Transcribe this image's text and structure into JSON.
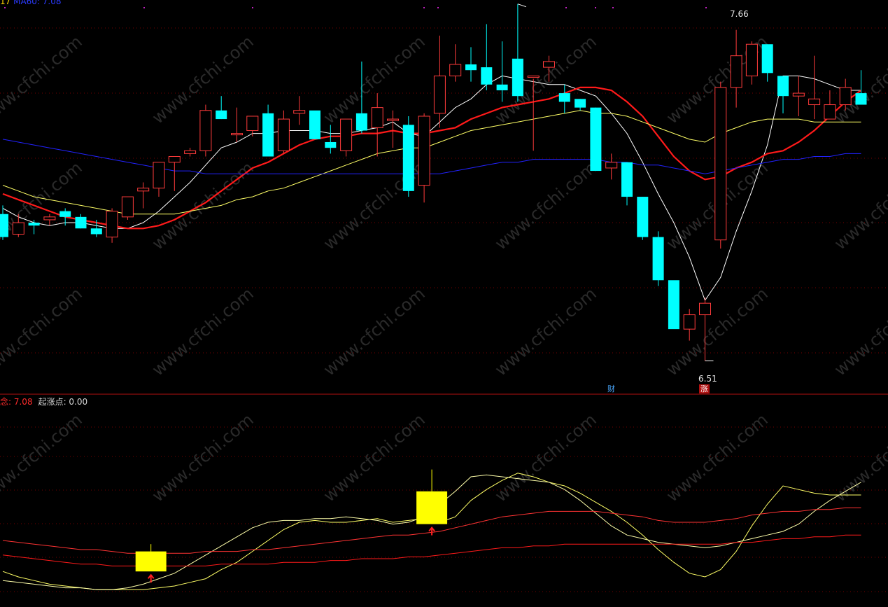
{
  "legend": {
    "top_fragment_1": "17",
    "top_fragment_2": "MA60: 7.08",
    "lower_value": "念: 7.08",
    "lower_start_label": "起涨点: 0.00"
  },
  "annotations": {
    "high_label": "7.66",
    "low_label": "6.51",
    "tag_cai": "财",
    "tag_zhang": "涨"
  },
  "colors": {
    "background": "#000000",
    "up_candle": "#ff3b3b",
    "down_candle": "#00ffff",
    "ma_white": "#ffffff",
    "ma_red": "#ff1a1a",
    "ma_yellow": "#ffff66",
    "ma_blue": "#2222ff",
    "signal_box": "#ffff00",
    "grid": "#8b0000"
  },
  "chart_data": [
    {
      "type": "candlestick",
      "title": "",
      "ylim": [
        6.45,
        7.72
      ],
      "grid": true,
      "candles": [
        {
          "o": 7.02,
          "h": 7.05,
          "l": 6.93,
          "c": 6.94
        },
        {
          "o": 6.95,
          "h": 7.02,
          "l": 6.94,
          "c": 6.99
        },
        {
          "o": 6.99,
          "h": 7.0,
          "l": 6.95,
          "c": 6.98
        },
        {
          "o": 7.0,
          "h": 7.02,
          "l": 6.98,
          "c": 7.01
        },
        {
          "o": 7.03,
          "h": 7.04,
          "l": 6.98,
          "c": 7.01
        },
        {
          "o": 7.01,
          "h": 7.02,
          "l": 6.97,
          "c": 6.97
        },
        {
          "o": 6.97,
          "h": 7.0,
          "l": 6.94,
          "c": 6.95
        },
        {
          "o": 6.94,
          "h": 7.04,
          "l": 6.92,
          "c": 7.03
        },
        {
          "o": 7.01,
          "h": 7.08,
          "l": 7.0,
          "c": 7.08
        },
        {
          "o": 7.1,
          "h": 7.13,
          "l": 7.04,
          "c": 7.11
        },
        {
          "o": 7.11,
          "h": 7.2,
          "l": 7.08,
          "c": 7.2
        },
        {
          "o": 7.2,
          "h": 7.22,
          "l": 7.1,
          "c": 7.22
        },
        {
          "o": 7.23,
          "h": 7.25,
          "l": 7.22,
          "c": 7.24
        },
        {
          "o": 7.24,
          "h": 7.4,
          "l": 7.22,
          "c": 7.38
        },
        {
          "o": 7.38,
          "h": 7.43,
          "l": 7.35,
          "c": 7.35
        },
        {
          "o": 7.3,
          "h": 7.39,
          "l": 7.27,
          "c": 7.3
        },
        {
          "o": 7.31,
          "h": 7.35,
          "l": 7.29,
          "c": 7.36
        },
        {
          "o": 7.37,
          "h": 7.4,
          "l": 7.22,
          "c": 7.22
        },
        {
          "o": 7.24,
          "h": 7.38,
          "l": 7.23,
          "c": 7.35
        },
        {
          "o": 7.37,
          "h": 7.43,
          "l": 7.33,
          "c": 7.38
        },
        {
          "o": 7.38,
          "h": 7.37,
          "l": 7.28,
          "c": 7.28
        },
        {
          "o": 7.27,
          "h": 7.33,
          "l": 7.23,
          "c": 7.25
        },
        {
          "o": 7.24,
          "h": 7.35,
          "l": 7.22,
          "c": 7.35
        },
        {
          "o": 7.37,
          "h": 7.55,
          "l": 7.3,
          "c": 7.31
        },
        {
          "o": 7.32,
          "h": 7.44,
          "l": 7.22,
          "c": 7.39
        },
        {
          "o": 7.35,
          "h": 7.38,
          "l": 7.25,
          "c": 7.35
        },
        {
          "o": 7.33,
          "h": 7.36,
          "l": 7.08,
          "c": 7.1
        },
        {
          "o": 7.12,
          "h": 7.37,
          "l": 7.06,
          "c": 7.36
        },
        {
          "o": 7.37,
          "h": 7.64,
          "l": 7.32,
          "c": 7.5
        },
        {
          "o": 7.5,
          "h": 7.61,
          "l": 7.48,
          "c": 7.54
        },
        {
          "o": 7.54,
          "h": 7.6,
          "l": 7.48,
          "c": 7.52
        },
        {
          "o": 7.53,
          "h": 7.68,
          "l": 7.45,
          "c": 7.47
        },
        {
          "o": 7.47,
          "h": 7.62,
          "l": 7.41,
          "c": 7.45
        },
        {
          "o": 7.56,
          "h": 7.75,
          "l": 7.41,
          "c": 7.43
        },
        {
          "o": 7.5,
          "h": 7.49,
          "l": 7.24,
          "c": 7.5
        },
        {
          "o": 7.53,
          "h": 7.57,
          "l": 7.48,
          "c": 7.55
        },
        {
          "o": 7.44,
          "h": 7.47,
          "l": 7.37,
          "c": 7.41
        },
        {
          "o": 7.42,
          "h": 7.42,
          "l": 7.38,
          "c": 7.39
        },
        {
          "o": 7.39,
          "h": 7.39,
          "l": 7.17,
          "c": 7.17
        },
        {
          "o": 7.18,
          "h": 7.23,
          "l": 7.14,
          "c": 7.2
        },
        {
          "o": 7.2,
          "h": 7.2,
          "l": 7.05,
          "c": 7.08
        },
        {
          "o": 7.08,
          "h": 7.08,
          "l": 6.93,
          "c": 6.94
        },
        {
          "o": 6.94,
          "h": 6.96,
          "l": 6.77,
          "c": 6.79
        },
        {
          "o": 6.79,
          "h": 6.78,
          "l": 6.63,
          "c": 6.62
        },
        {
          "o": 6.62,
          "h": 6.69,
          "l": 6.58,
          "c": 6.67
        },
        {
          "o": 6.67,
          "h": 6.73,
          "l": 6.51,
          "c": 6.71
        },
        {
          "o": 6.93,
          "h": 7.48,
          "l": 6.9,
          "c": 7.46
        },
        {
          "o": 7.46,
          "h": 7.66,
          "l": 7.39,
          "c": 7.57
        },
        {
          "o": 7.5,
          "h": 7.62,
          "l": 7.47,
          "c": 7.61
        },
        {
          "o": 7.61,
          "h": 7.6,
          "l": 7.48,
          "c": 7.51
        },
        {
          "o": 7.5,
          "h": 7.48,
          "l": 7.37,
          "c": 7.43
        },
        {
          "o": 7.43,
          "h": 7.5,
          "l": 7.36,
          "c": 7.44
        },
        {
          "o": 7.4,
          "h": 7.57,
          "l": 7.35,
          "c": 7.42
        },
        {
          "o": 7.35,
          "h": 7.45,
          "l": 7.35,
          "c": 7.4
        },
        {
          "o": 7.4,
          "h": 7.49,
          "l": 7.38,
          "c": 7.46
        },
        {
          "o": 7.44,
          "h": 7.52,
          "l": 7.41,
          "c": 7.4
        }
      ],
      "lines": [
        {
          "name": "MA5",
          "color": "#ffffff",
          "width": 1,
          "values": [
            7.04,
            7.01,
            6.99,
            6.98,
            6.99,
            6.99,
            6.98,
            6.97,
            6.97,
            6.99,
            7.03,
            7.08,
            7.13,
            7.19,
            7.25,
            7.27,
            7.3,
            7.3,
            7.31,
            7.31,
            7.31,
            7.3,
            7.3,
            7.31,
            7.32,
            7.34,
            7.3,
            7.29,
            7.34,
            7.39,
            7.42,
            7.47,
            7.5,
            7.49,
            7.48,
            7.47,
            7.47,
            7.45,
            7.43,
            7.37,
            7.3,
            7.2,
            7.09,
            6.99,
            6.87,
            6.72,
            6.8,
            6.96,
            7.1,
            7.26,
            7.5,
            7.5,
            7.49,
            7.47,
            7.45,
            7.45
          ]
        },
        {
          "name": "MA10",
          "color": "#ff1a1a",
          "width": 2.2,
          "values": [
            7.09,
            7.07,
            7.05,
            7.03,
            7.01,
            7.0,
            6.99,
            6.98,
            6.97,
            6.97,
            6.98,
            7.0,
            7.03,
            7.06,
            7.1,
            7.14,
            7.18,
            7.2,
            7.23,
            7.26,
            7.28,
            7.29,
            7.29,
            7.3,
            7.3,
            7.31,
            7.3,
            7.3,
            7.31,
            7.32,
            7.35,
            7.37,
            7.39,
            7.4,
            7.41,
            7.42,
            7.44,
            7.46,
            7.46,
            7.45,
            7.41,
            7.36,
            7.29,
            7.22,
            7.17,
            7.14,
            7.15,
            7.18,
            7.2,
            7.23,
            7.24,
            7.27,
            7.31,
            7.36,
            7.41,
            7.45
          ]
        },
        {
          "name": "MA20",
          "color": "#ffff66",
          "width": 1,
          "values": [
            7.12,
            7.1,
            7.08,
            7.07,
            7.06,
            7.05,
            7.04,
            7.03,
            7.02,
            7.02,
            7.02,
            7.02,
            7.03,
            7.04,
            7.05,
            7.07,
            7.08,
            7.1,
            7.11,
            7.13,
            7.15,
            7.17,
            7.19,
            7.21,
            7.23,
            7.24,
            7.25,
            7.25,
            7.27,
            7.29,
            7.31,
            7.32,
            7.33,
            7.34,
            7.35,
            7.36,
            7.37,
            7.38,
            7.37,
            7.37,
            7.36,
            7.34,
            7.32,
            7.3,
            7.28,
            7.27,
            7.3,
            7.32,
            7.34,
            7.35,
            7.35,
            7.35,
            7.34,
            7.34,
            7.34,
            7.34
          ]
        },
        {
          "name": "MA60",
          "color": "#2222ff",
          "width": 1,
          "values": [
            7.28,
            7.27,
            7.26,
            7.25,
            7.24,
            7.23,
            7.22,
            7.21,
            7.2,
            7.19,
            7.18,
            7.17,
            7.17,
            7.16,
            7.16,
            7.16,
            7.16,
            7.16,
            7.16,
            7.16,
            7.16,
            7.16,
            7.16,
            7.16,
            7.16,
            7.16,
            7.16,
            7.16,
            7.16,
            7.17,
            7.18,
            7.19,
            7.2,
            7.2,
            7.21,
            7.21,
            7.21,
            7.21,
            7.21,
            7.2,
            7.2,
            7.19,
            7.19,
            7.18,
            7.17,
            7.16,
            7.17,
            7.18,
            7.19,
            7.2,
            7.21,
            7.21,
            7.22,
            7.22,
            7.23,
            7.23
          ]
        }
      ]
    },
    {
      "type": "line",
      "title": "",
      "ylim": [
        0,
        100
      ],
      "grid": true,
      "series": [
        {
          "color": "#ffff66",
          "width": 1,
          "values": [
            13,
            10,
            8,
            6,
            5,
            4,
            3,
            3,
            3,
            3,
            4,
            5,
            7,
            9,
            14,
            18,
            24,
            30,
            36,
            40,
            41,
            40,
            40,
            41,
            42,
            40,
            41,
            42,
            40,
            43,
            52,
            58,
            63,
            67,
            65,
            62,
            60,
            56,
            51,
            46,
            40,
            33,
            25,
            18,
            12,
            10,
            14,
            24,
            38,
            50,
            60,
            58,
            56,
            55,
            55,
            55
          ]
        },
        {
          "color": "#ffffaa",
          "width": 1,
          "values": [
            8,
            7,
            6,
            5,
            4,
            4,
            3,
            3,
            4,
            6,
            9,
            12,
            17,
            22,
            27,
            32,
            37,
            40,
            41,
            41,
            42,
            42,
            43,
            42,
            41,
            39,
            40,
            43,
            50,
            57,
            65,
            66,
            65,
            64,
            63,
            62,
            58,
            52,
            45,
            38,
            33,
            31,
            29,
            28,
            27,
            26,
            27,
            29,
            31,
            33,
            35,
            39,
            46,
            52,
            57,
            62
          ]
        },
        {
          "color": "#ff3333",
          "width": 1,
          "values": [
            30,
            29,
            28,
            27,
            26,
            25,
            25,
            24,
            23,
            23,
            23,
            23,
            23,
            24,
            24,
            24,
            25,
            25,
            26,
            27,
            28,
            29,
            30,
            31,
            32,
            33,
            33,
            34,
            35,
            37,
            39,
            41,
            43,
            44,
            45,
            46,
            46,
            46,
            46,
            45,
            44,
            43,
            41,
            40,
            40,
            40,
            41,
            42,
            44,
            45,
            46,
            46,
            47,
            47,
            48,
            48
          ]
        },
        {
          "color": "#ff1a1a",
          "width": 1,
          "values": [
            22,
            21,
            20,
            19,
            18,
            17,
            17,
            16,
            16,
            16,
            16,
            16,
            16,
            16,
            17,
            17,
            17,
            17,
            18,
            18,
            18,
            19,
            19,
            20,
            20,
            20,
            21,
            21,
            22,
            23,
            24,
            25,
            26,
            26,
            27,
            27,
            28,
            28,
            28,
            28,
            28,
            28,
            28,
            28,
            28,
            28,
            28,
            29,
            29,
            30,
            31,
            31,
            32,
            32,
            33,
            33
          ]
        }
      ],
      "signals": [
        {
          "index": 9,
          "box_low": 13,
          "box_high": 24,
          "wick_high": 28,
          "arrow": true
        },
        {
          "index": 27,
          "box_low": 39,
          "box_high": 57,
          "wick_high": 69,
          "arrow": true
        }
      ]
    }
  ]
}
